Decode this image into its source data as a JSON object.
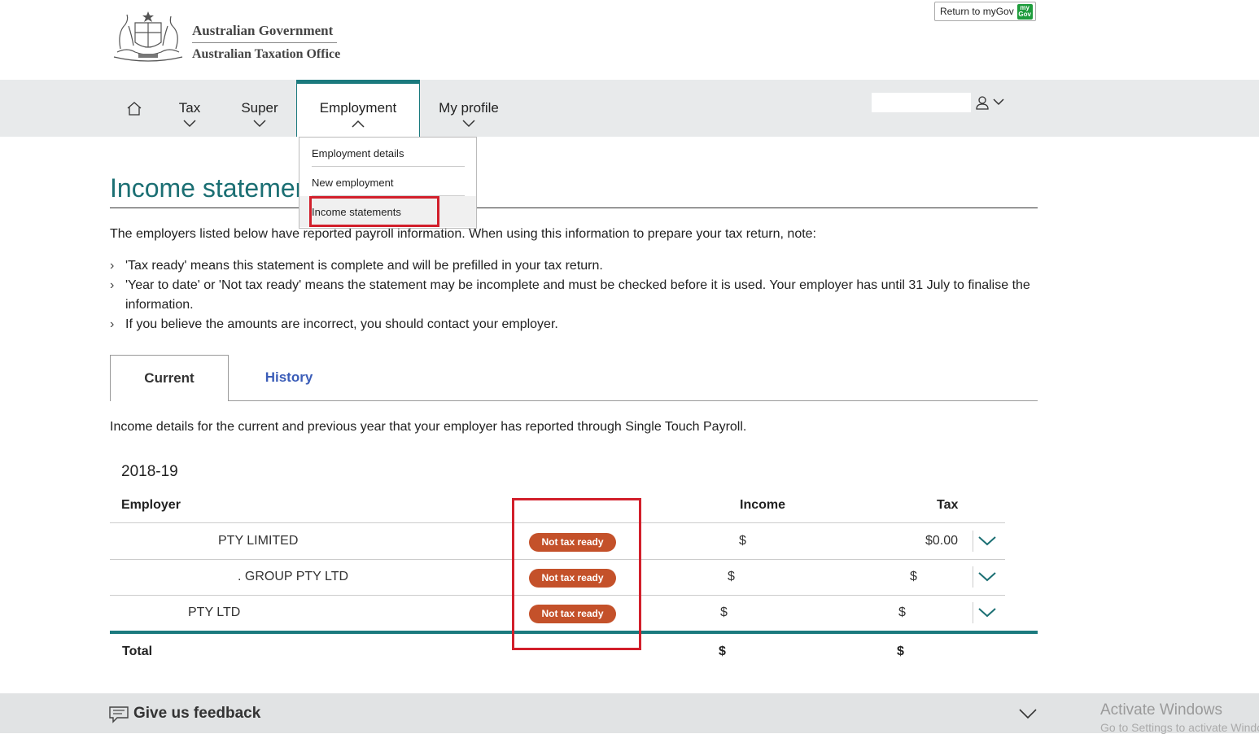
{
  "header": {
    "gov_name": "Australian Government",
    "agency_name": "Australian Taxation Office",
    "return_button": "Return to myGov",
    "mygov_logo_line1": "my",
    "mygov_logo_line2": "Gov",
    "mygov_logo_color": "#1e9c3c"
  },
  "nav": {
    "home_icon": "home-icon",
    "items": [
      {
        "label": "Tax"
      },
      {
        "label": "Super"
      },
      {
        "label": "Employment"
      },
      {
        "label": "My profile"
      }
    ],
    "active_item": "Employment",
    "accent_color": "#1b7a7e",
    "user_icon": "user-icon"
  },
  "dropdown": {
    "items": [
      {
        "label": "Employment details"
      },
      {
        "label": "New employment"
      },
      {
        "label": "Income statements"
      }
    ],
    "selected": "Income statements"
  },
  "page": {
    "title": "Income statements",
    "intro": "The employers listed below have reported payroll information. When using this information to prepare your tax return, note:",
    "notes": [
      "'Tax ready' means this statement is complete and will be prefilled in your tax return.",
      "'Year to date' or 'Not tax ready' means the statement may be incomplete and must be checked before it is used. Your employer has until 31 July to finalise the information.",
      "If you believe the amounts are incorrect, you should contact your employer."
    ]
  },
  "tabs": {
    "current": "Current",
    "history": "History",
    "description": "Income details for the current and previous year that your employer has reported through Single Touch Payroll."
  },
  "table": {
    "year": "2018-19",
    "headers": {
      "employer": "Employer",
      "income": "Income",
      "tax": "Tax"
    },
    "rows": [
      {
        "employer": "PTY LIMITED",
        "status": "Not tax ready",
        "income": "$",
        "tax": "$0.00"
      },
      {
        "employer": ". GROUP PTY LTD",
        "status": "Not tax ready",
        "income": "$",
        "tax": "$"
      },
      {
        "employer": "PTY LTD",
        "status": "Not tax ready",
        "income": "$",
        "tax": "$"
      }
    ],
    "total": {
      "label": "Total",
      "income": "$",
      "tax": "$"
    },
    "status_color": "#c4512a"
  },
  "footer": {
    "feedback": "Give us feedback"
  },
  "watermark": {
    "line1": "Activate Windows",
    "line2": "Go to Settings to activate Windows."
  }
}
